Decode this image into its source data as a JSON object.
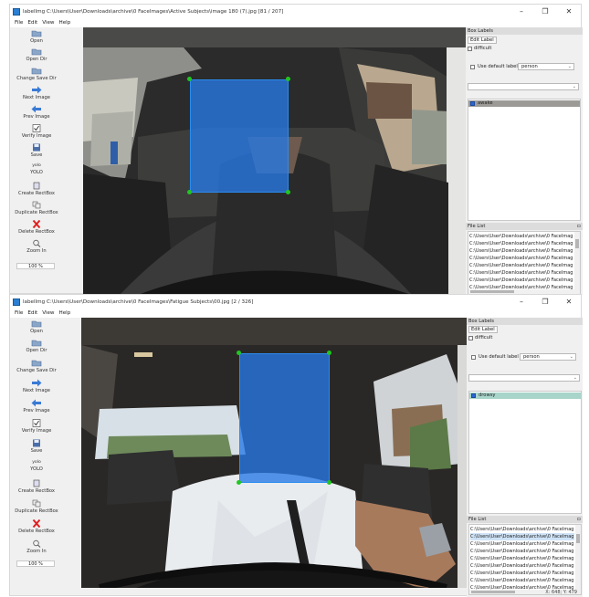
{
  "windows": [
    {
      "title": "labelImg C:\\Users\\User\\Downloads\\archive\\0 FaceImages\\Active Subjects\\image 180 (7).jpg [81 / 207]",
      "menu": [
        "File",
        "Edit",
        "View",
        "Help"
      ],
      "window_controls": [
        "–",
        "❐",
        "✕"
      ],
      "tools": [
        "Open",
        "Open Dir",
        "Change Save Dir",
        "Next Image",
        "Prev Image",
        "Verify Image",
        "Save",
        "YOLO",
        "Create RectBox",
        "Duplicate RectBox",
        "Delete RectBox",
        "Zoom In"
      ],
      "yolo_icon_text": "yolo",
      "zoom": "100 %",
      "box_labels_header": "Box Labels",
      "edit_label": "Edit Label",
      "difficult": "difficult",
      "use_default_label": "Use default label",
      "default_label_value": "person",
      "labels": [
        "awake"
      ],
      "file_list_header": "File List",
      "files": [
        "C:\\Users\\User\\Downloads\\archive\\0 FaceImag",
        "C:\\Users\\User\\Downloads\\archive\\0 FaceImag",
        "C:\\Users\\User\\Downloads\\archive\\0 FaceImag",
        "C:\\Users\\User\\Downloads\\archive\\0 FaceImag",
        "C:\\Users\\User\\Downloads\\archive\\0 FaceImag",
        "C:\\Users\\User\\Downloads\\archive\\0 FaceImag",
        "C:\\Users\\User\\Downloads\\archive\\0 FaceImag",
        "C:\\Users\\User\\Downloads\\archive\\0 FaceImag"
      ],
      "status": ""
    },
    {
      "title": "labelImg C:\\Users\\User\\Downloads\\archive\\0 FaceImages\\Fatigue Subjects\\00.jpg [2 / 326]",
      "menu": [
        "File",
        "Edit",
        "View",
        "Help"
      ],
      "window_controls": [
        "–",
        "❐",
        "✕"
      ],
      "tools": [
        "Open",
        "Open Dir",
        "Change Save Dir",
        "Next Image",
        "Prev Image",
        "Verify Image",
        "Save",
        "YOLO",
        "Create RectBox",
        "Duplicate RectBox",
        "Delete RectBox",
        "Zoom In"
      ],
      "yolo_icon_text": "yolo",
      "zoom": "100 %",
      "box_labels_header": "Box Labels",
      "edit_label": "Edit Label",
      "difficult": "difficult",
      "use_default_label": "Use default label",
      "default_label_value": "person",
      "labels": [
        "drowsy"
      ],
      "file_list_header": "File List",
      "files": [
        "C:\\Users\\User\\Downloads\\archive\\0 FaceImag",
        "C:\\Users\\User\\Downloads\\archive\\0 FaceImag",
        "C:\\Users\\User\\Downloads\\archive\\0 FaceImag",
        "C:\\Users\\User\\Downloads\\archive\\0 FaceImag",
        "C:\\Users\\User\\Downloads\\archive\\0 FaceImag",
        "C:\\Users\\User\\Downloads\\archive\\0 FaceImag",
        "C:\\Users\\User\\Downloads\\archive\\0 FaceImag",
        "C:\\Users\\User\\Downloads\\archive\\0 FaceImag",
        "C:\\Users\\User\\Downloads\\archive\\0 FaceImag"
      ],
      "status": "X: 648; Y: 479"
    }
  ],
  "colors": {
    "box_fill": "#2678e6",
    "handle": "#22c522",
    "label_selected": "#a8d5ca",
    "label_selected_1": "#9c9a96"
  }
}
